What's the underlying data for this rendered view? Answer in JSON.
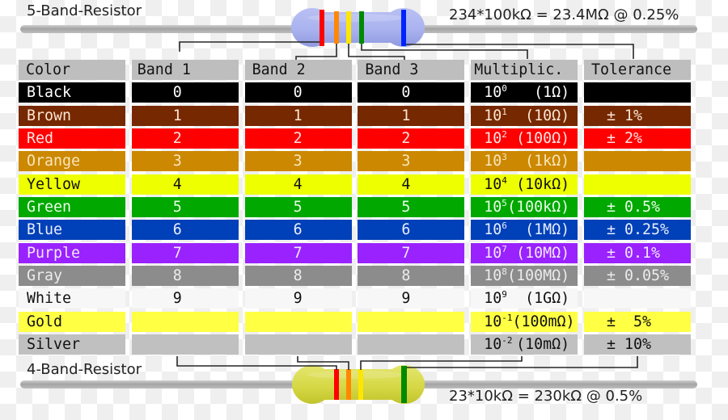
{
  "resistor_5band": {
    "title": "5-Band-Resistor",
    "formula": "234*100kΩ = 23.4MΩ @ 0.25%",
    "bands": [
      {
        "name": "red",
        "color": "#ff0000"
      },
      {
        "name": "orange",
        "color": "#ff8800"
      },
      {
        "name": "yellow",
        "color": "#ffe600"
      },
      {
        "name": "green",
        "color": "#008a00"
      },
      {
        "name": "blue",
        "color": "#0022ff"
      }
    ]
  },
  "resistor_4band": {
    "title": "4-Band-Resistor",
    "formula": "23*10kΩ = 230kΩ @ 0.5%",
    "bands": [
      {
        "name": "red",
        "color": "#ff0000"
      },
      {
        "name": "orange",
        "color": "#ff8800"
      },
      {
        "name": "yellow",
        "color": "#ffe600"
      },
      {
        "name": "green",
        "color": "#008a00"
      }
    ]
  },
  "table": {
    "headers": [
      "Color",
      "Band 1",
      "Band 2",
      "Band 3",
      "Multiplic.",
      "Tolerance"
    ],
    "rows": [
      {
        "color": "Black",
        "band1": "0",
        "band2": "0",
        "band3": "0",
        "multiplier": {
          "base": "10",
          "exp": "0",
          "value": "(1Ω)"
        },
        "tolerance": "",
        "bg": "#000000",
        "fg": "#ffffff"
      },
      {
        "color": "Brown",
        "band1": "1",
        "band2": "1",
        "band3": "1",
        "multiplier": {
          "base": "10",
          "exp": "1",
          "value": "(10Ω)"
        },
        "tolerance": "± 1%",
        "bg": "#762800",
        "fg": "#fbe6d2"
      },
      {
        "color": "Red",
        "band1": "2",
        "band2": "2",
        "band3": "2",
        "multiplier": {
          "base": "10",
          "exp": "2",
          "value": "(100Ω)"
        },
        "tolerance": "± 2%",
        "bg": "#ff0000",
        "fg": "#ffe4e4"
      },
      {
        "color": "Orange",
        "band1": "3",
        "band2": "3",
        "band3": "3",
        "multiplier": {
          "base": "10",
          "exp": "3",
          "value": "(1kΩ)"
        },
        "tolerance": "",
        "bg": "#cc8800",
        "fg": "#f8e6bc"
      },
      {
        "color": "Yellow",
        "band1": "4",
        "band2": "4",
        "band3": "4",
        "multiplier": {
          "base": "10",
          "exp": "4",
          "value": "(10kΩ)"
        },
        "tolerance": "",
        "bg": "#eeff00",
        "fg": "#111111"
      },
      {
        "color": "Green",
        "band1": "5",
        "band2": "5",
        "band3": "5",
        "multiplier": {
          "base": "10",
          "exp": "5",
          "value": "(100kΩ)"
        },
        "tolerance": "± 0.5%",
        "bg": "#00a800",
        "fg": "#eaffea"
      },
      {
        "color": "Blue",
        "band1": "6",
        "band2": "6",
        "band3": "6",
        "multiplier": {
          "base": "10",
          "exp": "6",
          "value": "(1MΩ)"
        },
        "tolerance": "± 0.25%",
        "bg": "#0040b8",
        "fg": "#e8eeff"
      },
      {
        "color": "Purple",
        "band1": "7",
        "band2": "7",
        "band3": "7",
        "multiplier": {
          "base": "10",
          "exp": "7",
          "value": "(10MΩ)"
        },
        "tolerance": "± 0.1%",
        "bg": "#9922ff",
        "fg": "#f2e6ff"
      },
      {
        "color": "Gray",
        "band1": "8",
        "band2": "8",
        "band3": "8",
        "multiplier": {
          "base": "10",
          "exp": "8",
          "value": "(100MΩ)"
        },
        "tolerance": "± 0.05%",
        "bg": "#8c8c8c",
        "fg": "#ececec"
      },
      {
        "color": "White",
        "band1": "9",
        "band2": "9",
        "band3": "9",
        "multiplier": {
          "base": "10",
          "exp": "9",
          "value": "(1GΩ)"
        },
        "tolerance": "",
        "bg": "#f7f7f7",
        "fg": "#111111"
      },
      {
        "color": "Gold",
        "band1": "",
        "band2": "",
        "band3": "",
        "multiplier": {
          "base": "10",
          "exp": "-1",
          "value": "(100mΩ)"
        },
        "tolerance": "±  5%",
        "bg": "#ffff44",
        "fg": "#111111"
      },
      {
        "color": "Silver",
        "band1": "",
        "band2": "",
        "band3": "",
        "multiplier": {
          "base": "10",
          "exp": "-2",
          "value": "(10mΩ)"
        },
        "tolerance": "± 10%",
        "bg": "#c0c0c0",
        "fg": "#111111"
      }
    ]
  }
}
